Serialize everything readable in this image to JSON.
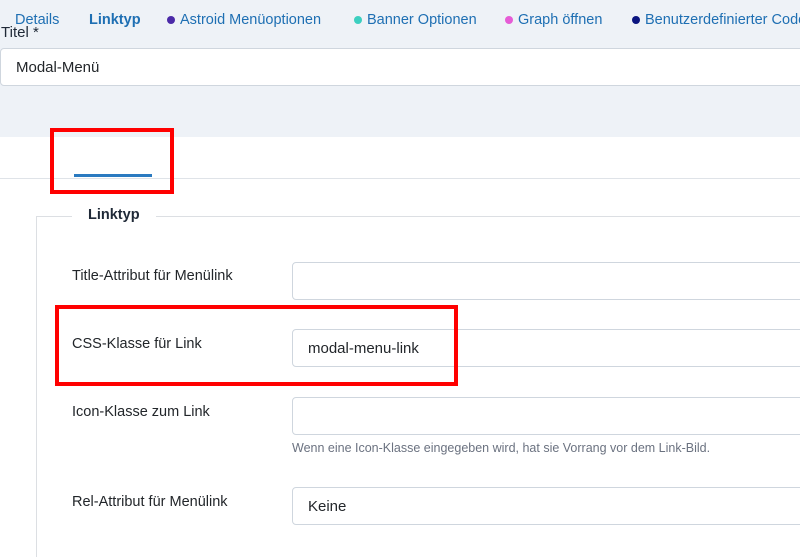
{
  "title_field": {
    "label": "Titel *",
    "value": "Modal-Menü"
  },
  "tabs": [
    {
      "label": "Details",
      "dot_color": null,
      "active": false
    },
    {
      "label": "Linktyp",
      "dot_color": null,
      "active": true
    },
    {
      "label": "Astroid Menüoptionen",
      "dot_color": "#4b2aa8",
      "active": false
    },
    {
      "label": "Banner Optionen",
      "dot_color": "#3ccfc0",
      "active": false
    },
    {
      "label": "Graph öffnen",
      "dot_color": "#e65cd6",
      "active": false
    },
    {
      "label": "Benutzerdefinierter Code",
      "dot_color": "#0b1580",
      "active": false
    }
  ],
  "fieldset": {
    "legend": "Linktyp",
    "fields": [
      {
        "label": "Title-Attribut für Menülink",
        "value": ""
      },
      {
        "label": "CSS-Klasse für Link",
        "value": "modal-menu-link"
      },
      {
        "label": "Icon-Klasse zum Link",
        "value": "",
        "hint": "Wenn eine Icon-Klasse eingegeben wird, hat sie Vorrang vor dem Link-Bild."
      },
      {
        "label": "Rel-Attribut für Menülink",
        "value": "Keine"
      }
    ]
  },
  "colors": {
    "accent": "#1e6fb3",
    "highlight": "#ff0000",
    "top_band": "#eef2f7"
  }
}
